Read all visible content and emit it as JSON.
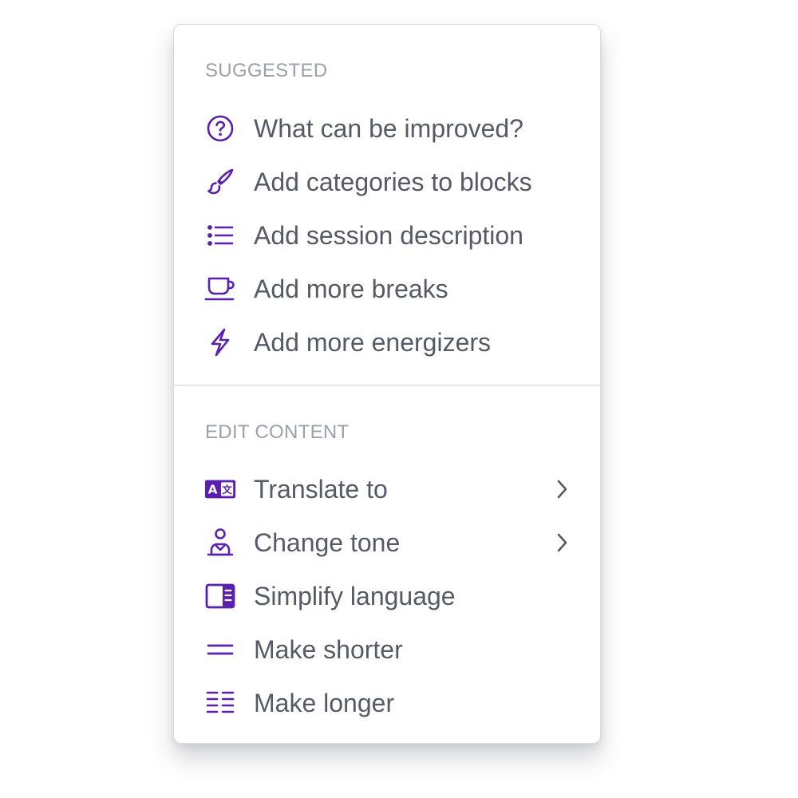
{
  "colors": {
    "accent": "#5b1fb0",
    "label_text": "#565a66",
    "section_text": "#9ca0ab",
    "divider": "#e3e5e9"
  },
  "suggested": {
    "heading": "SUGGESTED",
    "items": [
      {
        "icon": "question-circle-icon",
        "label": "What can be improved?"
      },
      {
        "icon": "paintbrush-icon",
        "label": "Add categories to blocks"
      },
      {
        "icon": "list-icon",
        "label": "Add session description"
      },
      {
        "icon": "coffee-cup-icon",
        "label": "Add more breaks"
      },
      {
        "icon": "lightning-bolt-icon",
        "label": "Add more energizers"
      }
    ]
  },
  "edit_content": {
    "heading": "EDIT CONTENT",
    "items": [
      {
        "icon": "translate-icon",
        "label": "Translate to",
        "has_submenu": true
      },
      {
        "icon": "presenter-icon",
        "label": "Change tone",
        "has_submenu": true
      },
      {
        "icon": "book-panel-icon",
        "label": "Simplify language"
      },
      {
        "icon": "equals-lines-icon",
        "label": "Make shorter"
      },
      {
        "icon": "multi-list-icon",
        "label": "Make longer"
      }
    ]
  }
}
